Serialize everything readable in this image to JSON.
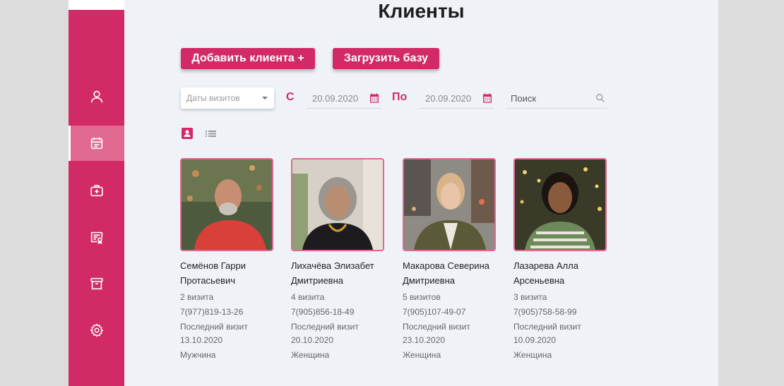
{
  "page": {
    "title": "Клиенты"
  },
  "toolbar": {
    "add_client_label": "Добавить клиента +",
    "upload_base_label": "Загрузить базу"
  },
  "filters": {
    "visit_dates_placeholder": "Даты визитов",
    "from_label": "С",
    "from_date": "20.09.2020",
    "to_label": "По",
    "to_date": "20.09.2020",
    "search_placeholder": "Поиск"
  },
  "sidebar": {
    "items": [
      {
        "icon": "user-icon"
      },
      {
        "icon": "calendar-icon",
        "active": true
      },
      {
        "icon": "medical-kit-icon"
      },
      {
        "icon": "certificate-icon"
      },
      {
        "icon": "archive-icon"
      },
      {
        "icon": "gear-icon"
      }
    ]
  },
  "view": {
    "active": "cards"
  },
  "clients": [
    {
      "name_line1": "Семёнов Гарри",
      "name_line2": "Протасьевич",
      "visits": "2 визита",
      "phone": "7(977)819-13-26",
      "last_visit_label": "Последний визит",
      "last_visit": "13.10.2020",
      "gender": "Мужчина"
    },
    {
      "name_line1": "Лихачёва Элизабет",
      "name_line2": "Дмитриевна",
      "visits": "4 визита",
      "phone": "7(905)856-18-49",
      "last_visit_label": "Последний визит",
      "last_visit": "20.10.2020",
      "gender": "Женщина"
    },
    {
      "name_line1": "Макарова Северина",
      "name_line2": "Дмитриевна",
      "visits": "5 визитов",
      "phone": "7(905)107-49-07",
      "last_visit_label": "Последний визит",
      "last_visit": "23.10.2020",
      "gender": "Женщина"
    },
    {
      "name_line1": "Лазарева Алла",
      "name_line2": "Арсеньевна",
      "visits": "3 визита",
      "phone": "7(905)758-58-99",
      "last_visit_label": "Последний визит",
      "last_visit": "10.09.2020",
      "gender": "Женщина"
    }
  ],
  "colors": {
    "accent": "#d12a66",
    "accent_light": "#e06891",
    "background": "#eff3f7"
  }
}
